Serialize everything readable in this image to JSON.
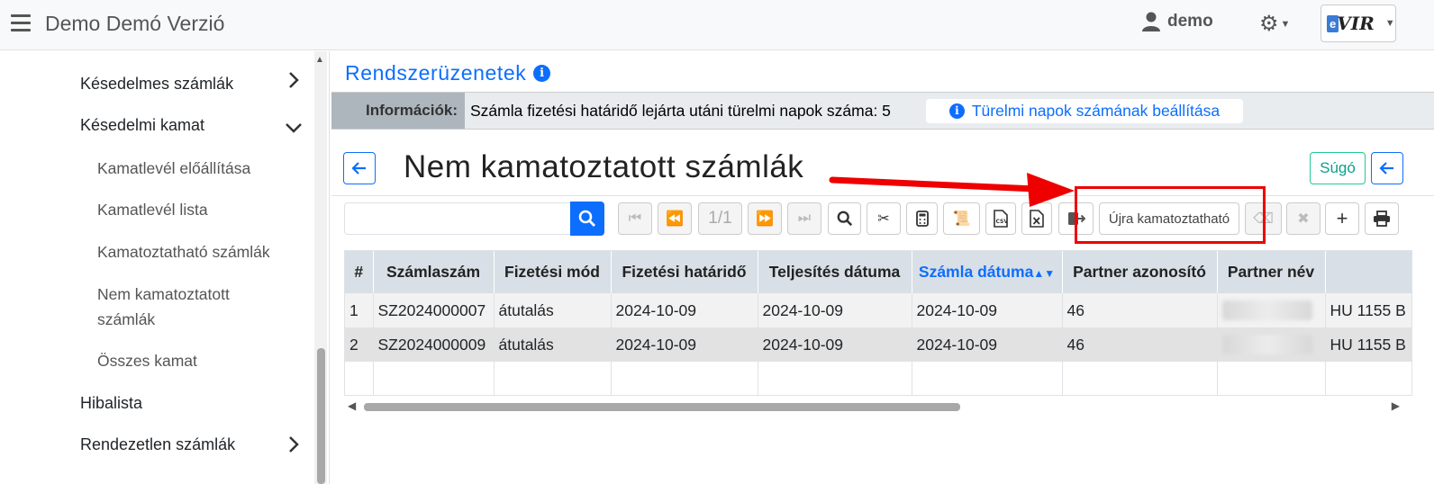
{
  "header": {
    "app_title": "Demo Demó Verzió",
    "user_name": "demo",
    "logo_e": "e",
    "logo_vir": "VIR"
  },
  "sidebar": {
    "items": [
      {
        "label": "Késedelmes számlák",
        "chevron": "›"
      },
      {
        "label": "Késedelmi kamat",
        "chevron": "⌄"
      },
      {
        "label": "Kamatlevél előállítása"
      },
      {
        "label": "Kamatlevél lista"
      },
      {
        "label": "Kamatoztatható számlák"
      },
      {
        "label": "Nem kamatoztatott",
        "label2": "számlák"
      },
      {
        "label": "Összes kamat"
      },
      {
        "label": "Hibalista"
      },
      {
        "label": "Rendezetlen számlák",
        "chevron": "›"
      }
    ]
  },
  "main": {
    "system_messages_title": "Rendszerüzenetek",
    "info_label": "Információk:",
    "info_text": "Számla fizetési határidő lejárta utáni türelmi napok száma: 5",
    "info_button": "Türelmi napok számának beállítása",
    "page_title": "Nem kamatoztatott számlák",
    "help_button": "Súgó",
    "search_placeholder": "",
    "pager": "1/1",
    "reinterest_button": "Újra kamatoztatható"
  },
  "table": {
    "columns": [
      "#",
      "Számlaszám",
      "Fizetési mód",
      "Fizetési határidő",
      "Teljesítés dátuma",
      "Számla dátuma",
      "Partner azonosító",
      "Partner név",
      ""
    ],
    "sorted_column": "Számla dátuma",
    "rows": [
      [
        "1",
        "SZ2024000007",
        "átutalás",
        "2024-10-09",
        "2024-10-09",
        "2024-10-09",
        "46",
        "",
        "HU 1155 B"
      ],
      [
        "2",
        "SZ2024000009",
        "átutalás",
        "2024-10-09",
        "2024-10-09",
        "2024-10-09",
        "46",
        "",
        "HU 1155 B"
      ]
    ]
  },
  "colors": {
    "accent": "#0d6efd",
    "annotation": "#e00000",
    "help": "#20c997"
  }
}
